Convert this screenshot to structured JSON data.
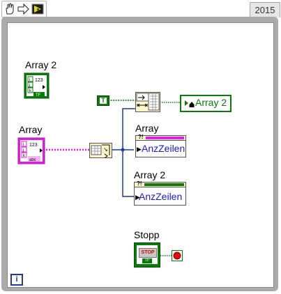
{
  "toolbar": {
    "tools": [
      "hand-tool",
      "arrow-tool",
      "run-icon"
    ],
    "version": "2015"
  },
  "diagram": {
    "array2_control_label": "Array 2",
    "array_control_label": "Array",
    "const_true": "T",
    "local_var_label": "Array 2",
    "node_array_label": "Array",
    "node_array_prop": "AnzZeilen",
    "node_array2_label": "Array 2",
    "node_array2_prop": "AnzZeilen",
    "stop_label": "Stopp",
    "stop_button_text": "STOP",
    "iteration_icon": "i",
    "array_icon_texts": [
      "123",
      "i",
      "j",
      "k",
      "TF"
    ],
    "string_array_icon_texts": [
      "123",
      "i",
      "j",
      "k",
      "abc"
    ]
  },
  "colors": {
    "wire_numeric": "#1f3a93",
    "wire_boolean": "#0a7a0a",
    "wire_string": "#e01fe0",
    "while_loop_frame": "#ababab"
  }
}
